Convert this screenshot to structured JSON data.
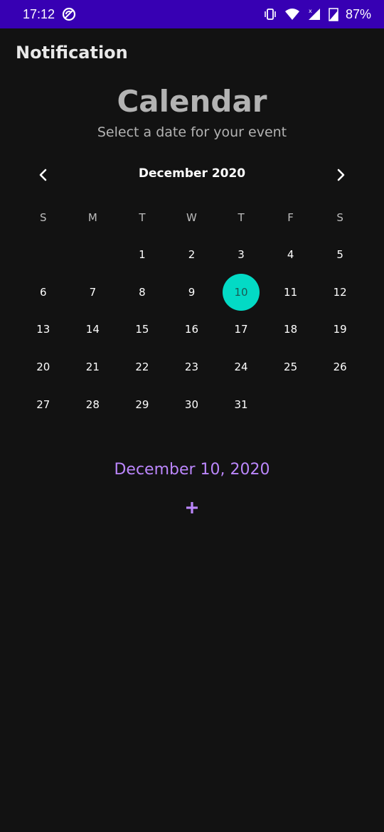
{
  "status_bar": {
    "time": "17:12",
    "battery": "87%",
    "icons": [
      "do-not-disturb-icon",
      "vibrate-icon",
      "wifi-icon",
      "cell-signal-icon",
      "battery-icon"
    ]
  },
  "app": {
    "title": "Notification"
  },
  "calendar": {
    "title": "Calendar",
    "subtitle": "Select a date for your event",
    "month_label": "December 2020",
    "weekdays": [
      "S",
      "M",
      "T",
      "W",
      "T",
      "F",
      "S"
    ],
    "leading_blanks": 2,
    "days": [
      "1",
      "2",
      "3",
      "4",
      "5",
      "6",
      "7",
      "8",
      "9",
      "10",
      "11",
      "12",
      "13",
      "14",
      "15",
      "16",
      "17",
      "18",
      "19",
      "20",
      "21",
      "22",
      "23",
      "24",
      "25",
      "26",
      "27",
      "28",
      "29",
      "30",
      "31"
    ],
    "selected_day": "10",
    "selected_color": "#03dac5"
  },
  "event": {
    "selected_date_text": "December 10, 2020",
    "add_label": "+",
    "accent_color": "#bb86fc"
  }
}
